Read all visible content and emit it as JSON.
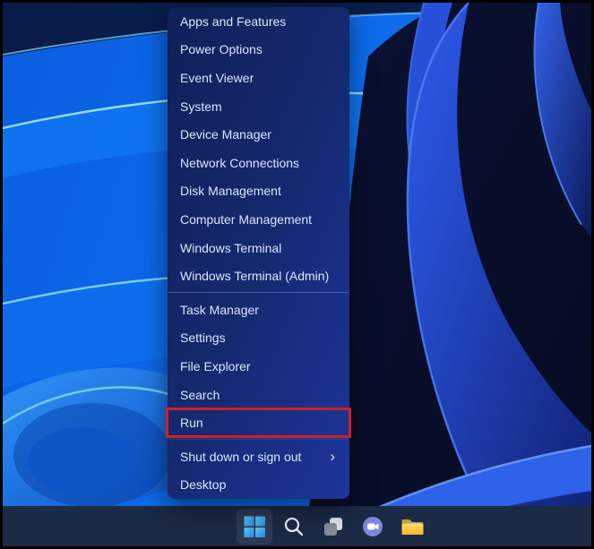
{
  "menu": {
    "items": [
      "Apps and Features",
      "Power Options",
      "Event Viewer",
      "System",
      "Device Manager",
      "Network Connections",
      "Disk Management",
      "Computer Management",
      "Windows Terminal",
      "Windows Terminal (Admin)",
      "Task Manager",
      "Settings",
      "File Explorer",
      "Search",
      "Run",
      "Shut down or sign out",
      "Desktop"
    ],
    "highlighted_item": "Run",
    "submenu_item": "Shut down or sign out",
    "submenu_arrow": "›"
  },
  "taskbar": {
    "icons": [
      "start",
      "search",
      "task-view",
      "chat",
      "file-explorer"
    ]
  },
  "colors": {
    "highlight_box": "#cf2026",
    "menu_background_start": "#111f58",
    "menu_background_end": "#1d349b",
    "menu_text": "#d8e6f8",
    "taskbar_background": "#1b2a45",
    "wallpaper_blue": "#0a5fe0"
  }
}
